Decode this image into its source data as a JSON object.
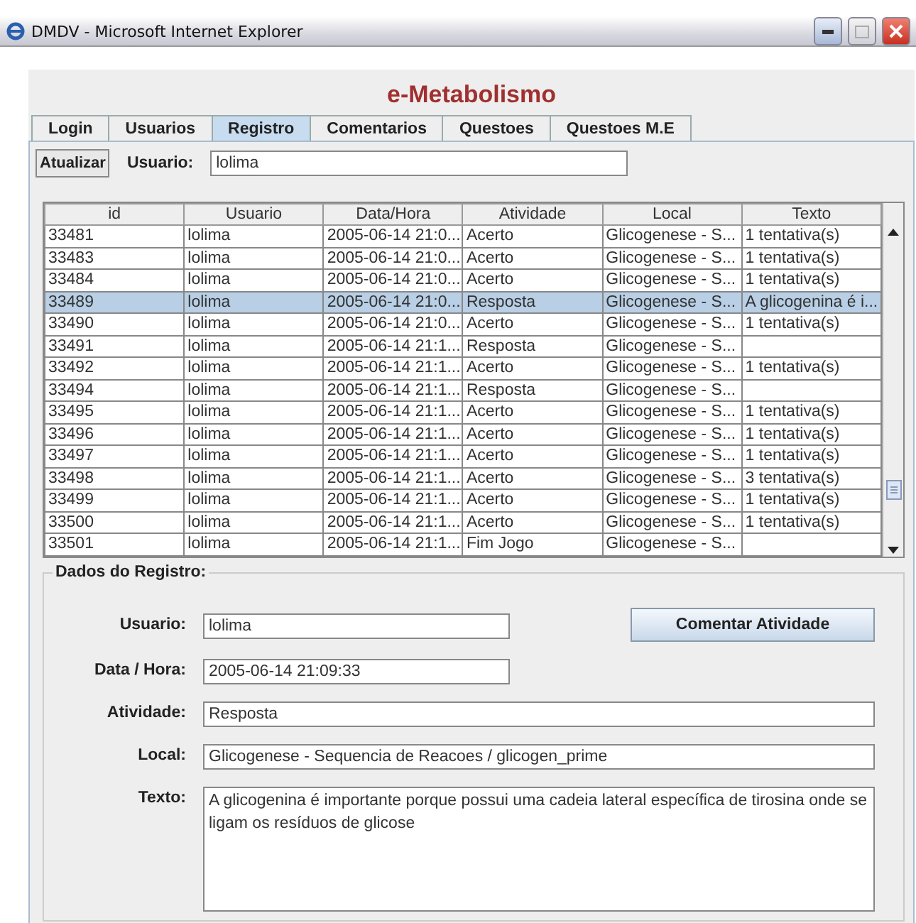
{
  "window": {
    "title": "DMDV - Microsoft Internet Explorer"
  },
  "app_title": "e-Metabolismo",
  "tabs": [
    {
      "label": "Login",
      "selected": false
    },
    {
      "label": "Usuarios",
      "selected": false
    },
    {
      "label": "Registro",
      "selected": true
    },
    {
      "label": "Comentarios",
      "selected": false
    },
    {
      "label": "Questoes",
      "selected": false
    },
    {
      "label": "Questoes M.E",
      "selected": false
    }
  ],
  "toolbar": {
    "button": "Atualizar",
    "user_label": "Usuario:",
    "user_value": "lolima"
  },
  "table": {
    "columns": [
      "id",
      "Usuario",
      "Data/Hora",
      "Atividade",
      "Local",
      "Texto"
    ],
    "rows": [
      {
        "cells": [
          "33481",
          "lolima",
          "2005-06-14 21:0...",
          "Acerto",
          "Glicogenese - S...",
          "1 tentativa(s)"
        ],
        "selected": false
      },
      {
        "cells": [
          "33483",
          "lolima",
          "2005-06-14 21:0...",
          "Acerto",
          "Glicogenese - S...",
          "1 tentativa(s)"
        ],
        "selected": false
      },
      {
        "cells": [
          "33484",
          "lolima",
          "2005-06-14 21:0...",
          "Acerto",
          "Glicogenese - S...",
          "1 tentativa(s)"
        ],
        "selected": false
      },
      {
        "cells": [
          "33489",
          "lolima",
          "2005-06-14 21:0...",
          "Resposta",
          "Glicogenese - S...",
          "A glicogenina é i..."
        ],
        "selected": true
      },
      {
        "cells": [
          "33490",
          "lolima",
          "2005-06-14 21:0...",
          "Acerto",
          "Glicogenese - S...",
          "1 tentativa(s)"
        ],
        "selected": false
      },
      {
        "cells": [
          "33491",
          "lolima",
          "2005-06-14 21:1...",
          "Resposta",
          "Glicogenese - S...",
          ""
        ],
        "selected": false
      },
      {
        "cells": [
          "33492",
          "lolima",
          "2005-06-14 21:1...",
          "Acerto",
          "Glicogenese - S...",
          "1 tentativa(s)"
        ],
        "selected": false
      },
      {
        "cells": [
          "33494",
          "lolima",
          "2005-06-14 21:1...",
          "Resposta",
          "Glicogenese - S...",
          ""
        ],
        "selected": false
      },
      {
        "cells": [
          "33495",
          "lolima",
          "2005-06-14 21:1...",
          "Acerto",
          "Glicogenese - S...",
          "1 tentativa(s)"
        ],
        "selected": false
      },
      {
        "cells": [
          "33496",
          "lolima",
          "2005-06-14 21:1...",
          "Acerto",
          "Glicogenese - S...",
          "1 tentativa(s)"
        ],
        "selected": false
      },
      {
        "cells": [
          "33497",
          "lolima",
          "2005-06-14 21:1...",
          "Acerto",
          "Glicogenese - S...",
          "1 tentativa(s)"
        ],
        "selected": false
      },
      {
        "cells": [
          "33498",
          "lolima",
          "2005-06-14 21:1...",
          "Acerto",
          "Glicogenese - S...",
          "3 tentativa(s)"
        ],
        "selected": false
      },
      {
        "cells": [
          "33499",
          "lolima",
          "2005-06-14 21:1...",
          "Acerto",
          "Glicogenese - S...",
          "1 tentativa(s)"
        ],
        "selected": false
      },
      {
        "cells": [
          "33500",
          "lolima",
          "2005-06-14 21:1...",
          "Acerto",
          "Glicogenese - S...",
          "1 tentativa(s)"
        ],
        "selected": false
      },
      {
        "cells": [
          "33501",
          "lolima",
          "2005-06-14 21:1...",
          "Fim Jogo",
          "Glicogenese - S...",
          ""
        ],
        "selected": false
      }
    ]
  },
  "details": {
    "legend": "Dados do Registro:",
    "button": "Comentar Atividade",
    "fields": [
      {
        "label": "Usuario:",
        "value": "lolima",
        "kind": "short"
      },
      {
        "label": "Data / Hora:",
        "value": "2005-06-14 21:09:33",
        "kind": "short"
      },
      {
        "label": "Atividade:",
        "value": "Resposta",
        "kind": "wide"
      },
      {
        "label": "Local:",
        "value": "Glicogenese - Sequencia de Reacoes / glicogen_prime",
        "kind": "wide"
      },
      {
        "label": "Texto:",
        "value": "A glicogenina é importante porque possui uma cadeia lateral específica de tirosina onde se ligam os resíduos de glicose",
        "kind": "area"
      }
    ]
  }
}
